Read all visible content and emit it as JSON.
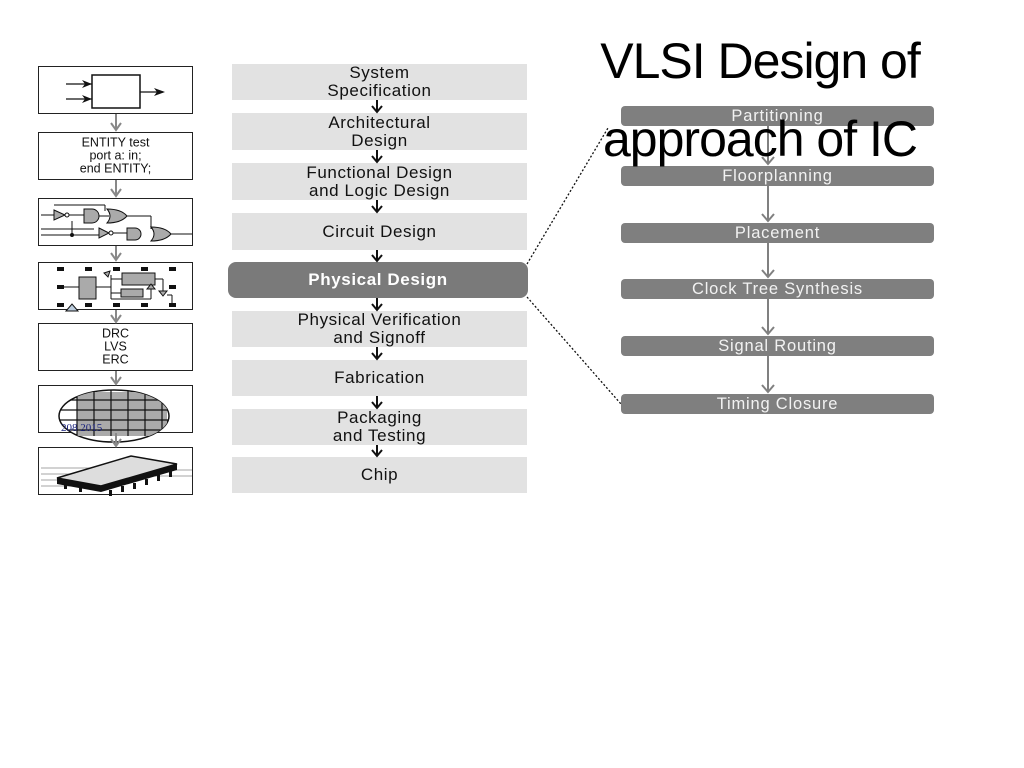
{
  "title": {
    "line1": "VLSI Design of",
    "line2": "approach of IC"
  },
  "icon_column": {
    "items": [
      {
        "name": "block-diagram-icon",
        "text": ""
      },
      {
        "name": "vhdl-code",
        "text": "ENTITY test\nport a: in;\nend ENTITY;"
      },
      {
        "name": "logic-gates-icon",
        "text": ""
      },
      {
        "name": "circuit-layout-icon",
        "text": ""
      },
      {
        "name": "verification-checks",
        "text": "DRC\nLVS\nERC"
      },
      {
        "name": "wafer-icon",
        "text": ""
      },
      {
        "name": "chip-package-icon",
        "text": ""
      }
    ],
    "wafer_overlay_label": "208 2015"
  },
  "design_flow": {
    "steps": [
      {
        "label": "System\nSpecification",
        "active": false
      },
      {
        "label": "Architectural\nDesign",
        "active": false
      },
      {
        "label": "Functional Design\nand Logic Design",
        "active": false
      },
      {
        "label": "Circuit Design",
        "active": false
      },
      {
        "label": "Physical Design",
        "active": true
      },
      {
        "label": "Physical Verification\nand Signoff",
        "active": false
      },
      {
        "label": "Fabrication",
        "active": false
      },
      {
        "label": "Packaging\nand Testing",
        "active": false
      },
      {
        "label": "Chip",
        "active": false
      }
    ]
  },
  "physical_design_flow": {
    "steps": [
      {
        "label": "Partitioning"
      },
      {
        "label": "Floorplanning"
      },
      {
        "label": "Placement"
      },
      {
        "label": "Clock Tree Synthesis"
      },
      {
        "label": "Signal Routing"
      },
      {
        "label": "Timing Closure"
      }
    ]
  },
  "colors": {
    "step_box": "#e2e2e2",
    "active_step": "#7a7a7a",
    "sub_step": "#7f7f7f",
    "connector_arrow": "#888888"
  }
}
